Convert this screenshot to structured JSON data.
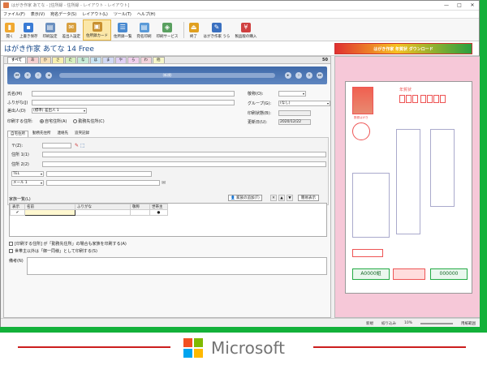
{
  "window": {
    "title": "はがき作家 あてな - [住所録 - 住所録 - レイアウト - レイアウト]",
    "controls": [
      "—",
      "□",
      "✕"
    ]
  },
  "menu": [
    "ファイル(F)",
    "表示(V)",
    "宛名データ(S)",
    "レイアウト(L)",
    "ツール(T)",
    "ヘルプ(H)"
  ],
  "toolbar": [
    "開く",
    "上書き保存",
    "印刷設定",
    "差出人設定",
    "住所録カード",
    "住所録一覧",
    "宛名印刷",
    "印刷サービス",
    "終了",
    "はがき作家 うら",
    "製品版の購入"
  ],
  "app_name": "はがき作家 あてな 14 Free",
  "banner": "はがき作家 年賀状 ダウンロード",
  "index_tabs": [
    "すべて",
    "あ",
    "か",
    "さ",
    "た",
    "な",
    "は",
    "ま",
    "や",
    "ら",
    "わ",
    "他"
  ],
  "index_count": "50",
  "nav_center": "(新規)",
  "labels": {
    "name": "氏名(M)",
    "furigana": "ふりがな(J)",
    "sender": "差出人(D)",
    "sender_value": "(標準) 差出人 1",
    "print_address": "印刷する住所:",
    "home_address": "自宅住所(A)",
    "work_address": "勤務先住所(C)",
    "title": "敬称(O):",
    "group": "グループ(G):",
    "group_value": "(なし)",
    "print_state": "印刷状態(B):",
    "updated": "更新日(U):",
    "updated_value": "2020/12/22"
  },
  "sub_tabs": [
    "自宅住所",
    "勤務先住所",
    "連絡先",
    "追突記録"
  ],
  "address": {
    "zip": "〒(Z):",
    "addr1": "住所 1(1)",
    "addr2": "住所 2(2)",
    "tel": "TEL",
    "mail": "メール 1"
  },
  "family": {
    "title": "家族一覧(L)",
    "add": "家族の追加(T)",
    "view": "簡易表示",
    "columns": [
      "表示",
      "名前",
      "ふりがな",
      "敬称",
      "世帯主"
    ]
  },
  "options": [
    "[印刷する住所] が「勤務先住所」の場合も家族を印刷する(A)",
    "世帯主以外は「御一同様」として印刷する(S)"
  ],
  "notes": "備考(N)",
  "card": {
    "postal_label": "年賀状",
    "post_name": "郵便はがき",
    "bottom_left": "A0000組",
    "bottom_right": "000000"
  },
  "status": [
    "新規",
    "絞り込み",
    "10%",
    "用紙範囲"
  ],
  "brand": {
    "name": "Microsoft",
    "colors": [
      "#f25022",
      "#7fba00",
      "#00a4ef",
      "#ffb900"
    ]
  }
}
